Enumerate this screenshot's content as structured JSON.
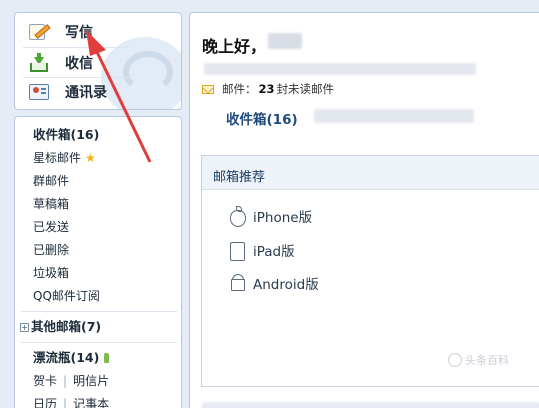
{
  "quick": {
    "write": "写信",
    "receive": "收信",
    "contacts": "通讯录"
  },
  "folders": {
    "inbox": "收件箱(16)",
    "starred": "星标邮件",
    "group": "群邮件",
    "drafts": "草稿箱",
    "sent": "已发送",
    "deleted": "已删除",
    "spam": "垃圾箱",
    "subscription": "QQ邮件订阅",
    "other_expand": "+",
    "other": "其他邮箱(7)",
    "drift": "漂流瓶(14)",
    "greeting_card": "贺卡",
    "postcard": "明信片",
    "calendar": "日历",
    "notepad": "记事本",
    "separator": "|"
  },
  "main": {
    "greeting": "晚上好，",
    "mail_label": "邮件：",
    "mail_count": "23",
    "mail_unread_suffix": "封未读邮件",
    "inbox_link": "收件箱(16)",
    "recommend_title": "邮箱推荐",
    "apps": [
      "iPhone版",
      "iPad版",
      "Android版"
    ]
  },
  "watermark": "头条百科",
  "colors": {
    "accent": "#1f4a7c",
    "annotation": "#e23d3d",
    "star": "#f3b51b"
  },
  "icons": [
    "pencil-icon",
    "inbox-arrow-icon",
    "contact-card-icon",
    "envelope-icon",
    "star-icon",
    "bottle-icon",
    "apple-icon",
    "ipad-icon",
    "android-icon"
  ]
}
